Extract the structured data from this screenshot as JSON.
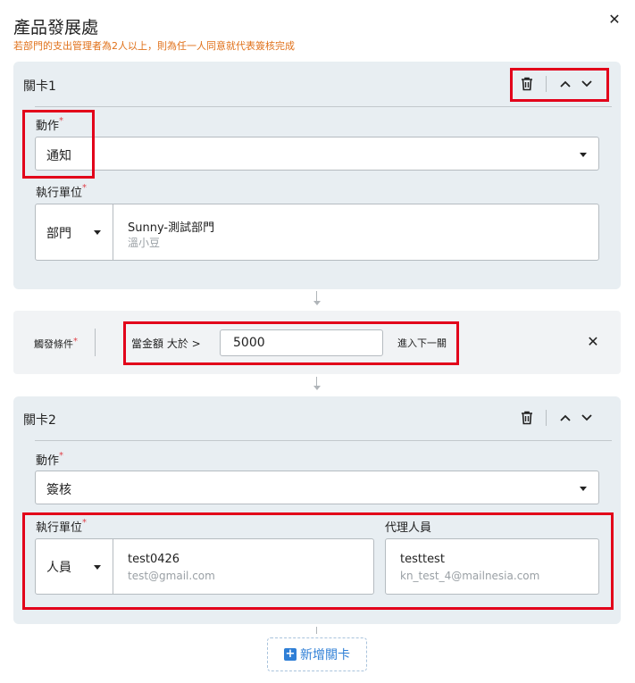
{
  "dialog": {
    "title": "產品發展處",
    "subtitle": "若部門的支出管理者為2人以上，則為任一人同意就代表簽核完成",
    "close_icon": "close-icon"
  },
  "stages": [
    {
      "title": "關卡1",
      "action_label": "動作",
      "action_value": "通知",
      "unit_label": "執行單位",
      "unit_type": "部門",
      "unit_name": "Sunny-測試部門",
      "unit_member": "溫小豆"
    },
    {
      "title": "關卡2",
      "action_label": "動作",
      "action_value": "簽核",
      "unit_label": "執行單位",
      "unit_type": "人員",
      "unit_name": "test0426",
      "unit_member": "test@gmail.com",
      "agent_label": "代理人員",
      "agent_name": "testtest",
      "agent_email": "kn_test_4@mailnesia.com"
    }
  ],
  "condition": {
    "label": "觸發條件",
    "prefix": "當金額 大於 >",
    "value": "5000",
    "suffix": "進入下一關"
  },
  "add_stage": {
    "label": "新增關卡"
  },
  "colors": {
    "accent": "#2f7fd6",
    "warning_text": "#e0711a",
    "highlight": "#e2001a",
    "panel": "#e8eef2"
  }
}
